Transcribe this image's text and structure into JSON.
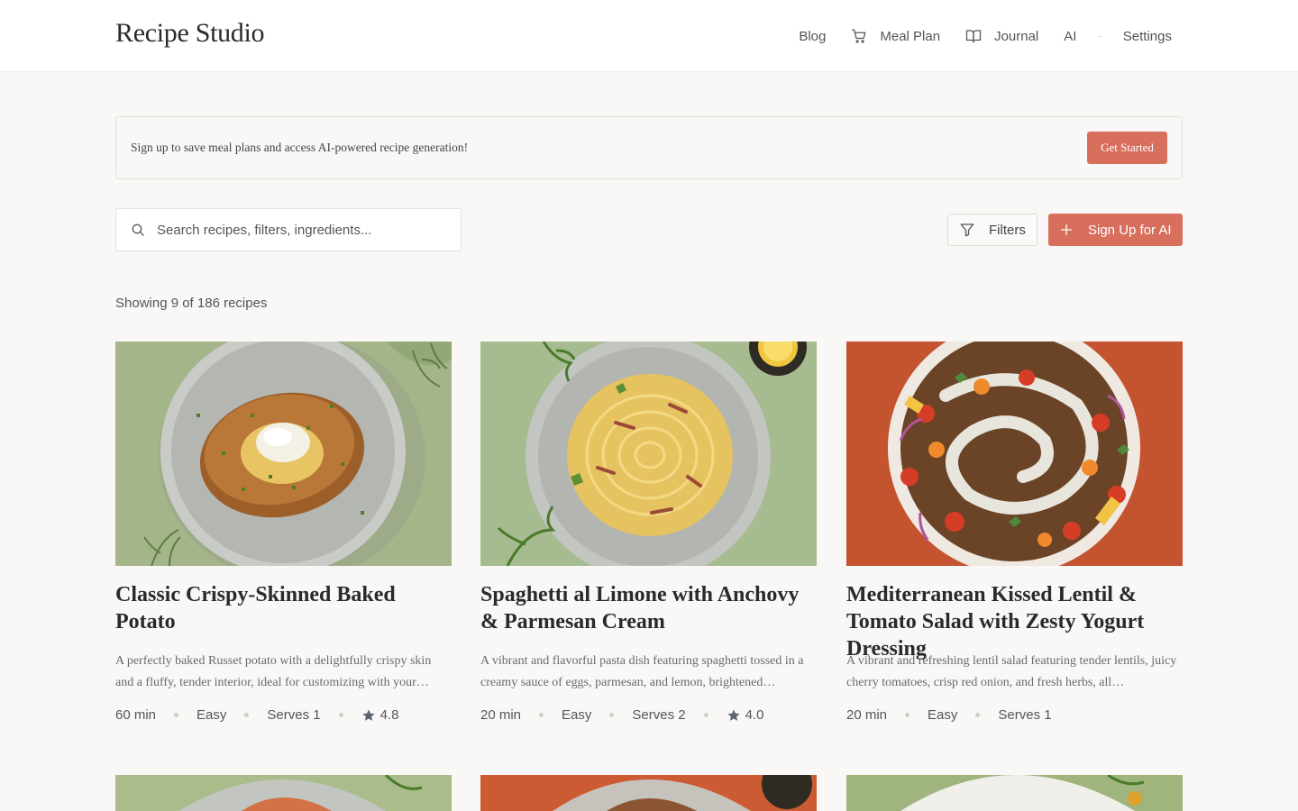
{
  "app": {
    "brand": "Recipe Studio"
  },
  "nav": {
    "blog": "Blog",
    "meal_plan": "Meal Plan",
    "journal": "Journal",
    "ai": "AI",
    "separator": "·",
    "settings": "Settings"
  },
  "banner": {
    "text": "Sign up to save meal plans and access AI-powered recipe generation!",
    "button": "Get Started"
  },
  "search": {
    "placeholder": "Search recipes, filters, ingredients..."
  },
  "toolbar": {
    "filters": "Filters",
    "signup_ai": "Sign Up for AI"
  },
  "results": {
    "count_text": "Showing 9 of 186 recipes"
  },
  "colors": {
    "accent": "#d86f5d",
    "background": "#f9f8f6",
    "sage": "#a3b68c",
    "terracotta": "#c4532f"
  },
  "recipes": [
    {
      "title": "Classic Crispy-Skinned Baked Potato",
      "description": "A perfectly baked Russet potato with a delightfully crispy skin and a fluffy, tender interior, ideal for customizing with your…",
      "time": "60 min",
      "difficulty": "Easy",
      "serves": "Serves 1",
      "rating": "4.8"
    },
    {
      "title": "Spaghetti al Limone with Anchovy & Parmesan Cream",
      "description": "A vibrant and flavorful pasta dish featuring spaghetti tossed in a creamy sauce of eggs, parmesan, and lemon, brightened…",
      "time": "20 min",
      "difficulty": "Easy",
      "serves": "Serves 2",
      "rating": "4.0"
    },
    {
      "title": "Mediterranean Kissed Lentil & Tomato Salad with Zesty Yogurt Dressing",
      "description": "A vibrant and refreshing lentil salad featuring tender lentils, juicy cherry tomatoes, crisp red onion, and fresh herbs, all…",
      "time": "20 min",
      "difficulty": "Easy",
      "serves": "Serves 1",
      "rating": ""
    }
  ]
}
